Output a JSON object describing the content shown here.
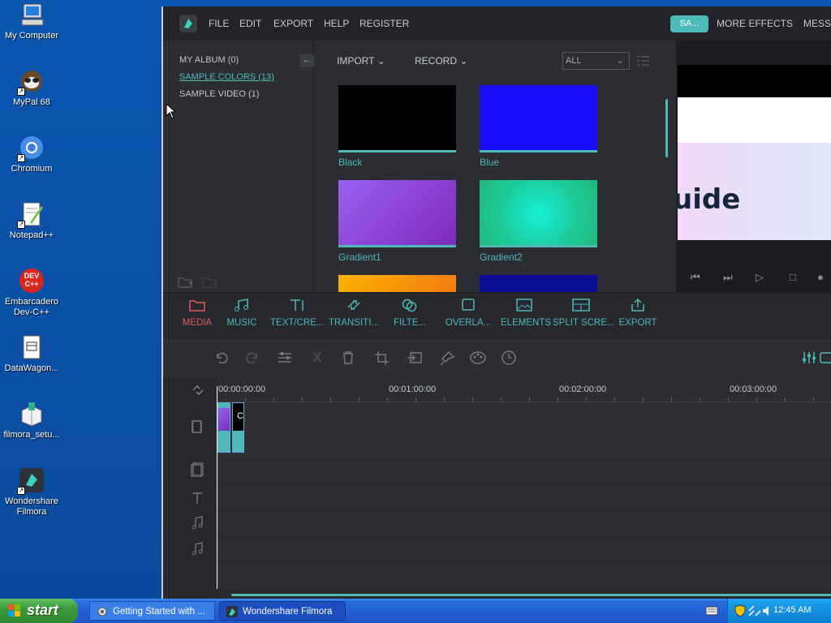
{
  "desktop": {
    "icons": [
      {
        "label": "My Computer",
        "icon": "computer-icon"
      },
      {
        "label": "MyPal 68",
        "icon": "mypal-icon"
      },
      {
        "label": "Chromium",
        "icon": "chromium-icon"
      },
      {
        "label": "Notepad++",
        "icon": "notepadpp-icon"
      },
      {
        "label": "Embarcadero Dev-C++",
        "icon": "devcpp-icon"
      },
      {
        "label": "DataWagon...",
        "icon": "datawagon-icon"
      },
      {
        "label": "filmora_setu...",
        "icon": "installer-icon"
      },
      {
        "label": "Wondershare Filmora",
        "icon": "filmora-icon"
      }
    ],
    "devcpp_badge": "DEV C++"
  },
  "filmora": {
    "menu": [
      "FILE",
      "EDIT",
      "EXPORT",
      "HELP",
      "REGISTER"
    ],
    "sa_button": "SA...",
    "more_effects": "MORE EFFECTS",
    "messages": "MESSA",
    "albums": [
      "MY ALBUM (0)",
      "SAMPLE COLORS (13)",
      "SAMPLE VIDEO (1)"
    ],
    "collapse_glyph": "←",
    "import_label": "IMPORT",
    "record_label": "RECORD",
    "filter_value": "ALL",
    "media_items": [
      {
        "label": "Black",
        "color": "#000000"
      },
      {
        "label": "Blue",
        "color": "#1a0dfa"
      },
      {
        "label": "Gradient1",
        "color": "#8a4cea"
      },
      {
        "label": "Gradient2",
        "color": "#1ed7a8"
      },
      {
        "label": "",
        "color": "#f58a0a"
      },
      {
        "label": "",
        "color": "#0d0e96"
      }
    ],
    "preview_text": "uide",
    "tabs": [
      {
        "label": "MEDIA",
        "icon": "folder-icon"
      },
      {
        "label": "MUSIC",
        "icon": "music-icon"
      },
      {
        "label": "TEXT/CRE...",
        "icon": "text-icon"
      },
      {
        "label": "TRANSITI...",
        "icon": "transition-icon"
      },
      {
        "label": "FILTE...",
        "icon": "filter-icon"
      },
      {
        "label": "OVERLA...",
        "icon": "overlay-icon"
      },
      {
        "label": "ELEMENTS",
        "icon": "image-icon"
      },
      {
        "label": "SPLIT SCRE...",
        "icon": "split-screen-icon"
      },
      {
        "label": "EXPORT",
        "icon": "export-icon"
      }
    ],
    "ruler": [
      "00:00:00:00",
      "00:01:00:00",
      "00:02:00:00",
      "00:03:00:00"
    ],
    "clip2_label": "C"
  },
  "taskbar": {
    "start": "start",
    "tasks": [
      {
        "label": "Getting Started with ...",
        "active": false
      },
      {
        "label": "Wondershare Filmora",
        "active": true
      }
    ],
    "clock": "12:45 AM"
  },
  "colors": {
    "accent": "#4eb9b9",
    "active_tab": "#e05a5a"
  }
}
